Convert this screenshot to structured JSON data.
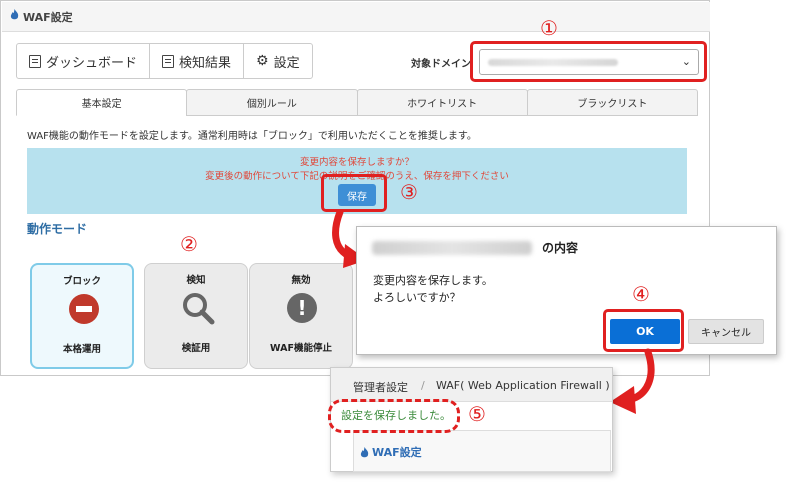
{
  "panel": {
    "title": "WAF設定"
  },
  "toolbar": {
    "dashboard_label": "ダッシュボード",
    "results_label": "検知結果",
    "settings_label": "設定"
  },
  "domain": {
    "label": "対象ドメイン"
  },
  "tabs": [
    "基本設定",
    "個別ルール",
    "ホワイトリスト",
    "ブラックリスト"
  ],
  "description": "WAF機能の動作モードを設定します。通常利用時は「ブロック」で利用いただくことを推奨します。",
  "confirm": {
    "line1": "変更内容を保存しますか？",
    "line2": "変更後の動作について下記の説明をご確認のうえ、保存を押下ください",
    "save_label": "保存"
  },
  "mode": {
    "heading": "動作モード",
    "cards": [
      {
        "title": "ブロック",
        "sub": "本格運用",
        "icon": "block-icon"
      },
      {
        "title": "検知",
        "sub": "検証用",
        "icon": "magnifier-icon"
      },
      {
        "title": "無効",
        "sub": "WAF機能停止",
        "icon": "warning-icon"
      }
    ]
  },
  "dialog": {
    "title_suffix": "の内容",
    "message_line1": "変更内容を保存します。",
    "message_line2": "よろしいですか？",
    "ok_label": "OK",
    "cancel_label": "キャンセル"
  },
  "result": {
    "crumb1": "管理者設定",
    "crumb_sep": "/",
    "crumb2": "WAF( Web Application Firewall )",
    "saved_message": "設定を保存しました。",
    "panel_title": "WAF設定"
  },
  "steps": [
    "①",
    "②",
    "③",
    "④",
    "⑤"
  ],
  "colors": {
    "annotation": "#e02020",
    "accent": "#2f6db5",
    "ok": "#0a6fd6"
  }
}
